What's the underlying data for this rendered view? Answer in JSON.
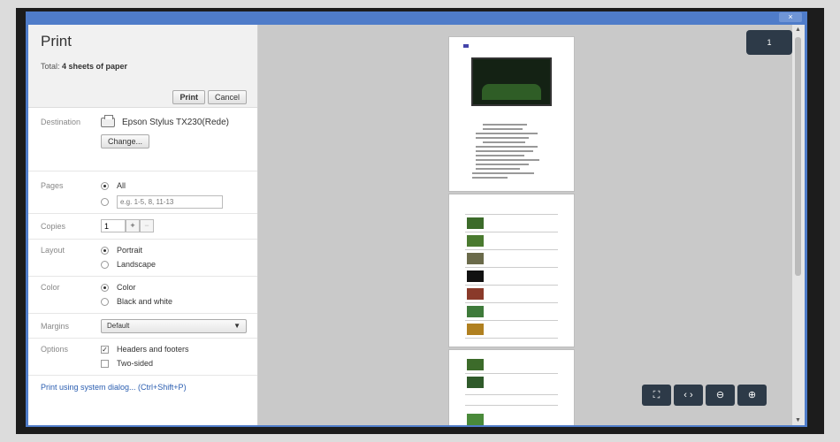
{
  "dialog": {
    "title": "Print",
    "total_prefix": "Total:",
    "total_value": "4 sheets of paper",
    "print_label": "Print",
    "cancel_label": "Cancel"
  },
  "destination": {
    "label": "Destination",
    "printer": "Epson Stylus TX230(Rede)",
    "change_label": "Change..."
  },
  "pages": {
    "label": "Pages",
    "all_label": "All",
    "range_placeholder": "e.g. 1-5, 8, 11-13"
  },
  "copies": {
    "label": "Copies",
    "value": "1",
    "plus": "+",
    "minus": "−"
  },
  "layout": {
    "label": "Layout",
    "portrait": "Portrait",
    "landscape": "Landscape"
  },
  "color": {
    "label": "Color",
    "color_option": "Color",
    "bw_option": "Black and white"
  },
  "margins": {
    "label": "Margins",
    "selected": "Default"
  },
  "options": {
    "label": "Options",
    "headers_footers": "Headers and footers",
    "two_sided": "Two-sided"
  },
  "system_dialog_link": "Print using system dialog... (Ctrl+Shift+P)",
  "preview": {
    "page_indicator": "1"
  },
  "window": {
    "close_glyph": "×"
  },
  "icons": {
    "printer": "printer-icon",
    "fit": "fit-to-page-icon",
    "width": "fit-width-icon",
    "zoom_out": "zoom-out-icon",
    "zoom_in": "zoom-in-icon"
  }
}
